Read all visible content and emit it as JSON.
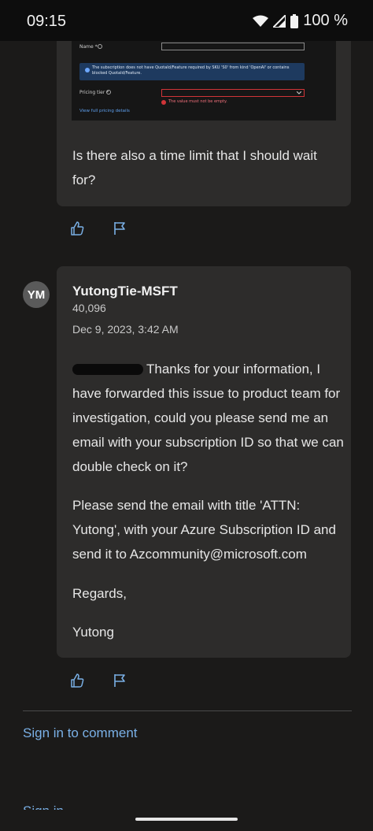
{
  "status_bar": {
    "time": "09:15",
    "battery": "100 %",
    "icons": [
      "wifi-icon",
      "cell-signal-icon",
      "battery-icon"
    ]
  },
  "embedded_screenshot": {
    "name_label": "Name *",
    "info_message": "The subscription does not have QuotaId/Feature required by SKU 'S0' from kind 'OpenAI' or contains blocked QuotaId/Feature.",
    "pricing_tier_label": "Pricing tier *",
    "error_message": "The value must not be empty.",
    "link": "View full pricing details"
  },
  "question": {
    "text": "Is there also a time limit that I should wait for?"
  },
  "answer": {
    "avatar_initials": "YM",
    "author": "YutongTie-MSFT",
    "reputation": "40,096",
    "date": "Dec 9, 2023, 3:42 AM",
    "paragraph1_tail": "Thanks for your information, I have forwarded this issue to product team for investigation, could you please send me an email with your subscription ID so that we can double check on it?",
    "paragraph2": "Please send the email with title 'ATTN: Yutong', with your Azure Subscription ID and send it to Azcommunity@microsoft.com",
    "paragraph3": "Regards,",
    "paragraph4": "Yutong"
  },
  "footer": {
    "sign_in_label": "Sign in to comment",
    "partial_label": "Sign in"
  },
  "colors": {
    "background": "#1b1a19",
    "card": "#2d2c2b",
    "link": "#7ab0e6"
  }
}
